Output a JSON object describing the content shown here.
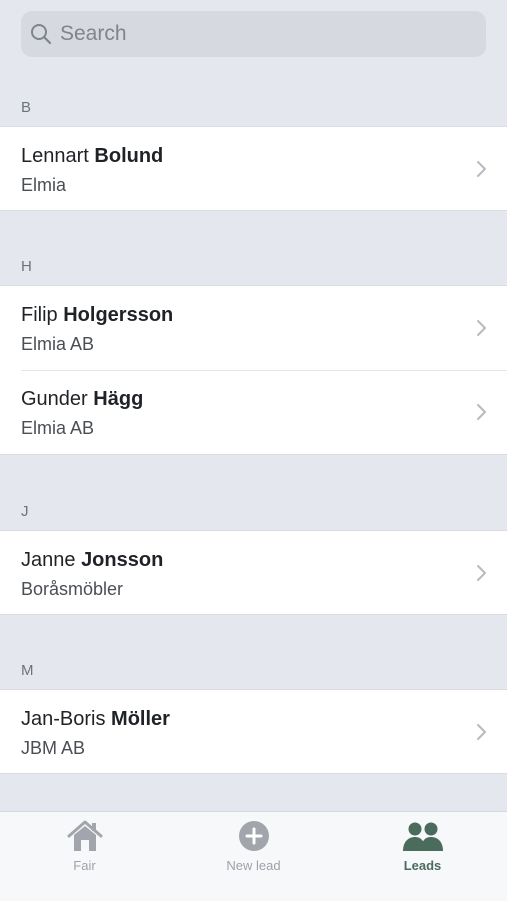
{
  "search": {
    "placeholder": "Search"
  },
  "sections": [
    {
      "letter": "B",
      "contacts": [
        {
          "first": "Lennart",
          "last": "Bolund",
          "company": "Elmia"
        }
      ]
    },
    {
      "letter": "H",
      "contacts": [
        {
          "first": "Filip",
          "last": "Holgersson",
          "company": "Elmia AB"
        },
        {
          "first": "Gunder",
          "last": "Hägg",
          "company": "Elmia AB"
        }
      ]
    },
    {
      "letter": "J",
      "contacts": [
        {
          "first": "Janne",
          "last": "Jonsson",
          "company": "Boråsmöbler"
        }
      ]
    },
    {
      "letter": "M",
      "contacts": [
        {
          "first": "Jan-Boris",
          "last": "Möller",
          "company": "JBM AB"
        }
      ]
    }
  ],
  "tabbar": {
    "tabs": [
      {
        "label": "Fair",
        "icon": "house-icon"
      },
      {
        "label": "New lead",
        "icon": "plus-circle-icon"
      },
      {
        "label": "Leads",
        "icon": "people-icon",
        "active": true
      }
    ]
  },
  "colors": {
    "background": "#e4e7ee",
    "active_tab": "#4b6b5d",
    "inactive_tab": "#9ea2a8"
  }
}
